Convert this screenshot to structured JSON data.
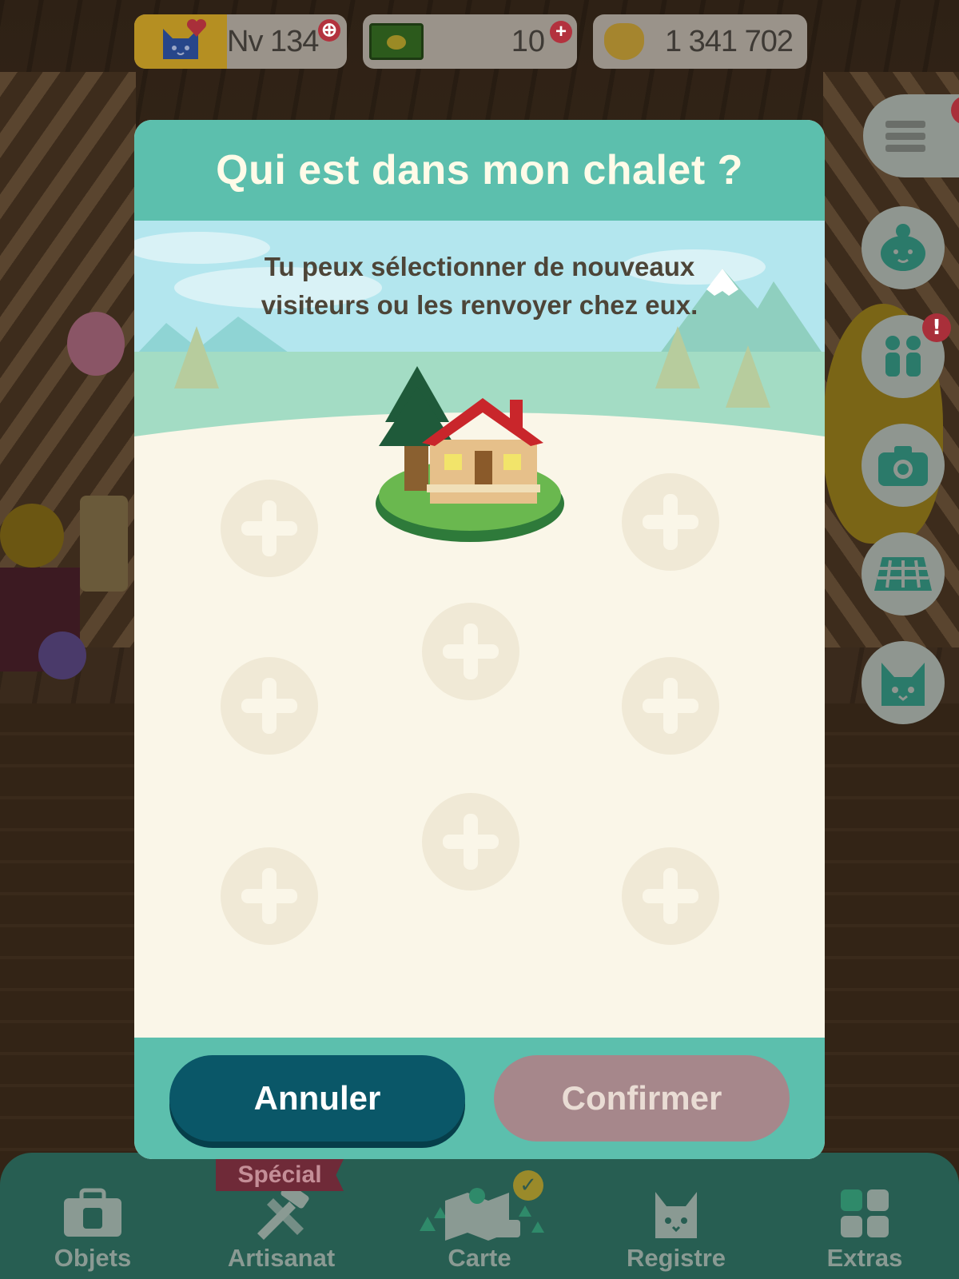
{
  "status_bar": {
    "level": "Nv 134",
    "tickets": "10",
    "bells": "1 341 702"
  },
  "dialog": {
    "title": "Qui est dans mon chalet ?",
    "message_line1": "Tu peux sélectionner de nouveaux",
    "message_line2": "visiteurs ou les renvoyer chez eux.",
    "slot_count": 8,
    "cancel_label": "Annuler",
    "confirm_label": "Confirmer",
    "confirm_enabled": false
  },
  "side_buttons": [
    "menu-icon",
    "isabelle-icon",
    "friends-icon",
    "camera-icon",
    "layout-grid-icon",
    "cat-icon"
  ],
  "bottom_nav": {
    "special_tag": "Spécial",
    "items": [
      {
        "label": "Objets",
        "icon": "bag-icon"
      },
      {
        "label": "Artisanat",
        "icon": "hammer-saw-icon"
      },
      {
        "label": "Carte",
        "icon": "map-icon"
      },
      {
        "label": "Registre",
        "icon": "cat-face-icon"
      },
      {
        "label": "Extras",
        "icon": "grid-icon"
      }
    ]
  },
  "colors": {
    "dialog_teal": "#5cbfad",
    "cancel_button": "#0a5768",
    "confirm_disabled": "#a6878b",
    "dialog_body": "#faf6e8",
    "alert_red": "#a92f3a"
  }
}
